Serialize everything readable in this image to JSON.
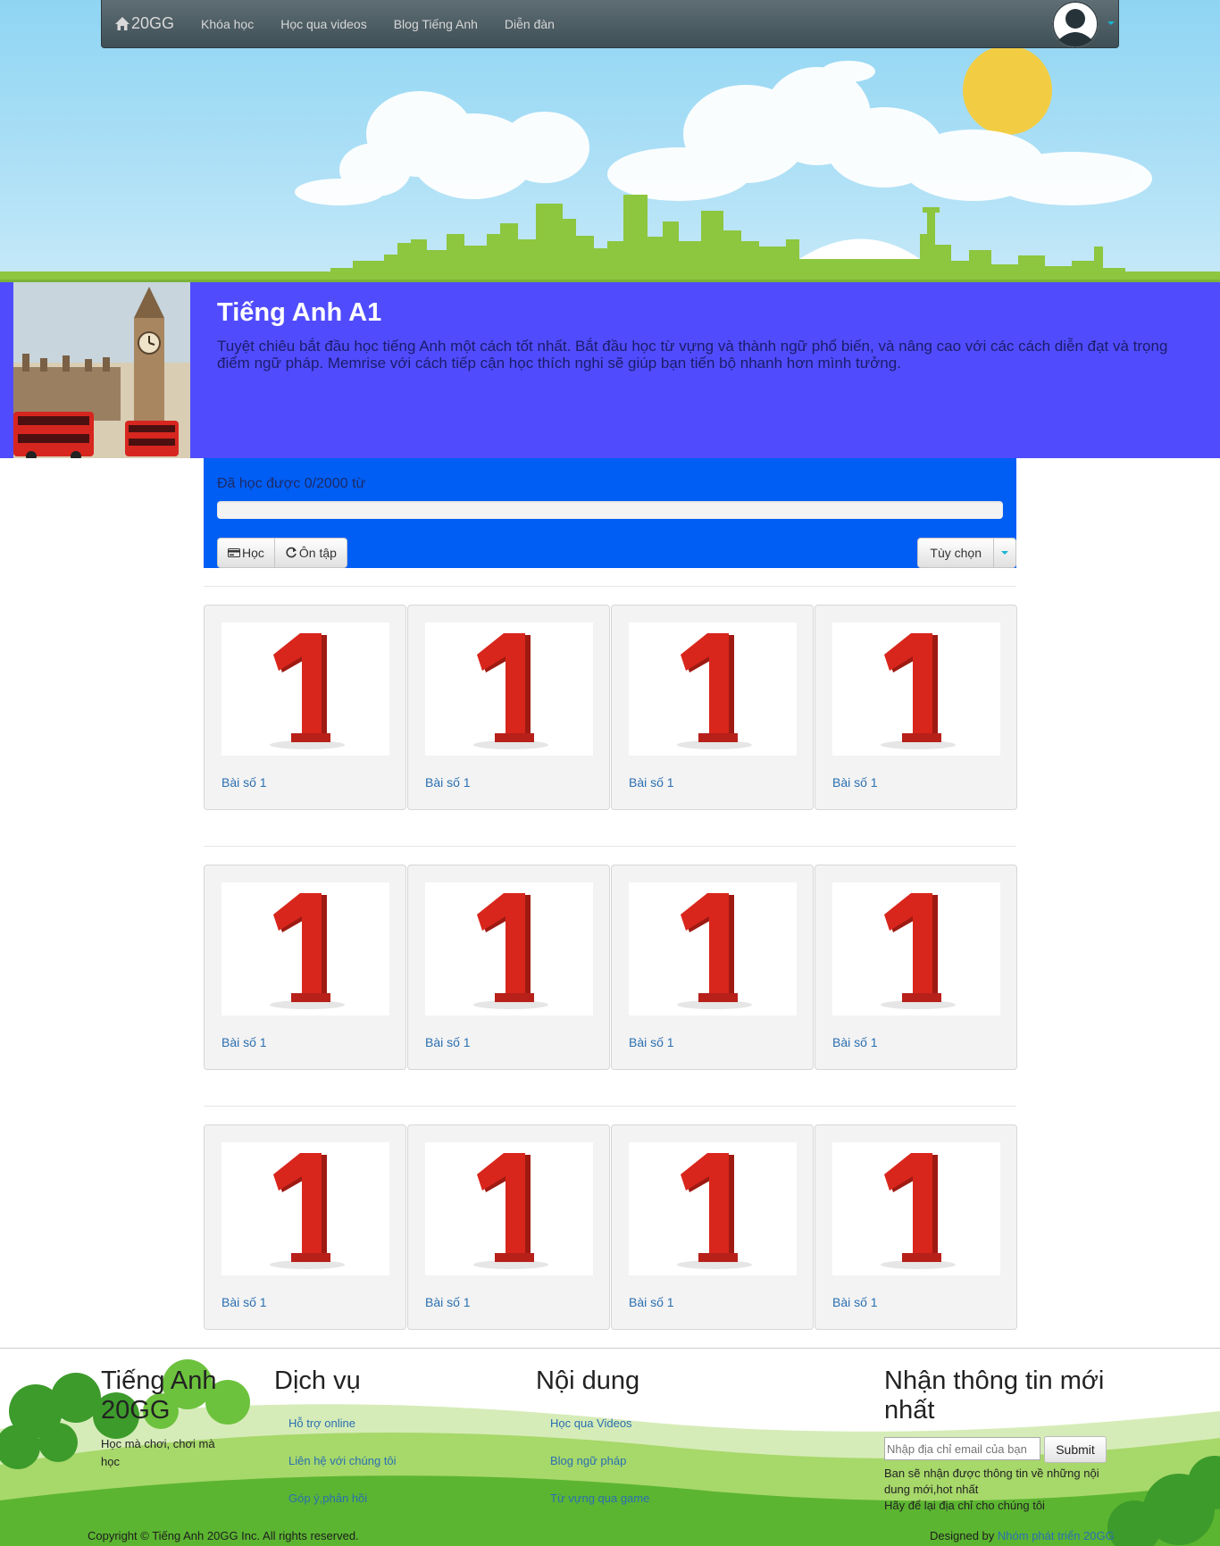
{
  "navbar": {
    "brand": "20GG",
    "links": [
      "Khóa học",
      "Học qua videos",
      "Blog Tiếng Anh",
      "Diễn đàn"
    ]
  },
  "course": {
    "title": "Tiếng Anh A1",
    "description": "Tuyệt chiêu bắt đầu học tiếng Anh một cách tốt nhất. Bắt đầu học từ vựng và thành ngữ phổ biến, và nâng cao với các cách diễn đạt và trọng điểm ngữ pháp. Memrise với cách tiếp cận học thích nghi sẽ giúp bạn tiến bộ nhanh hơn mình tưởng."
  },
  "progress": {
    "label": "Đã học được 0/2000 từ",
    "learned": 0,
    "total": 2000,
    "fraction": 0,
    "learn_button": "Học",
    "review_button": "Ôn tập",
    "options_button": "Tùy chọn"
  },
  "lessons": [
    [
      "Bài số 1",
      "Bài số 1",
      "Bài số 1",
      "Bài số 1"
    ],
    [
      "Bài số 1",
      "Bài số 1",
      "Bài số 1",
      "Bài số 1"
    ],
    [
      "Bài số 1",
      "Bài số 1",
      "Bài số 1",
      "Bài số 1"
    ]
  ],
  "footer": {
    "brand": "Tiếng Anh 20GG",
    "tagline": "Học mà chơi, chơi mà học",
    "services": {
      "heading": "Dịch vụ",
      "links": [
        "Hỗ trợ online",
        "Liên hệ với chúng tôi",
        "Góp ý,phản hồi"
      ]
    },
    "content": {
      "heading": "Nội dung",
      "links": [
        "Học qua Videos",
        "Blog ngữ pháp",
        "Từ vựng qua game"
      ]
    },
    "newsletter": {
      "heading": "Nhận thông tin mới nhất",
      "placeholder": "Nhập địa chỉ email của bạn",
      "submit": "Submit",
      "note": "Ban sẽ nhận được thông tin về những nội dung mới,hot nhất\nHãy để lại địa chỉ cho chúng tôi"
    },
    "copyright": "Copyright © Tiếng Anh 20GG Inc. All rights reserved.",
    "designed_by_label": "Designed by",
    "designed_by_link": "Nhóm phát triển 20GG"
  },
  "colors": {
    "course_header_bg": "#504cfd",
    "progress_panel_bg": "#005ef5",
    "link": "#2a6fb0"
  }
}
